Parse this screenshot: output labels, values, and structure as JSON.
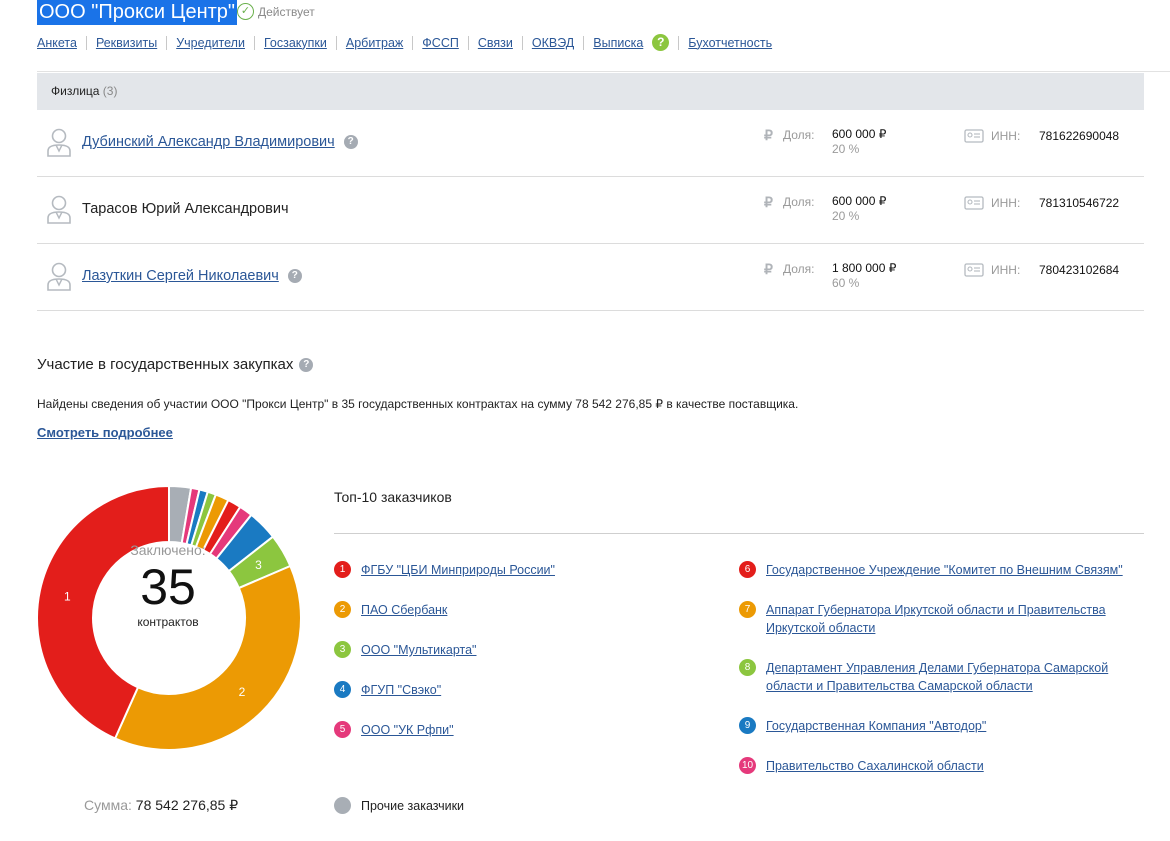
{
  "company": {
    "title": "ООО \"Прокси Центр\"",
    "status": "Действует"
  },
  "nav": [
    "Анкета",
    "Реквизиты",
    "Учредители",
    "Госзакупки",
    "Арбитраж",
    "ФССП",
    "Связи",
    "ОКВЭД",
    "Выписка",
    "Бухотчетность"
  ],
  "nav_help": "?",
  "founders": {
    "header": "Физлица",
    "count": "(3)",
    "share_label": "Доля:",
    "inn_label": "ИНН:",
    "rub_sign": "₽",
    "persons": [
      {
        "name": "Дубинский Александр Владимирович",
        "share": "600 000 ₽",
        "percent": "20 %",
        "inn": "781622690048"
      },
      {
        "name": "Тарасов Юрий Александрович",
        "share": "600 000 ₽",
        "percent": "20 %",
        "inn": "781310546722"
      },
      {
        "name": "Лазуткин Сергей Николаевич",
        "share": "1 800 000 ₽",
        "percent": "60 %",
        "inn": "780423102684"
      }
    ]
  },
  "procurement": {
    "title": "Участие в государственных закупках",
    "found_text": "Найдены сведения об участии ООО \"Прокси Центр\" в 35 государственных контрактах на сумму 78 542 276,85 ₽ в качестве поставщика.",
    "more_link": "Смотреть подробнее",
    "donut_label": "Заключено:",
    "contracts_count": "35",
    "contracts_unit": "контрактов",
    "sum_label": "Сумма:",
    "sum_value": "78 542 276,85 ₽",
    "top10_title": "Топ-10 заказчиков",
    "customers": [
      {
        "n": "1",
        "name": "ФГБУ \"ЦБИ Минприроды России\"",
        "color": "#e31e1b"
      },
      {
        "n": "2",
        "name": "ПАО Сбербанк",
        "color": "#ec9a04"
      },
      {
        "n": "3",
        "name": "ООО \"Мультикарта\"",
        "color": "#8cc63f"
      },
      {
        "n": "4",
        "name": "ФГУП \"Свэко\"",
        "color": "#1a7ac2"
      },
      {
        "n": "5",
        "name": "ООО \"УК Рфпи\"",
        "color": "#e5397b"
      },
      {
        "n": "6",
        "name": "Государственное Учреждение \"Комитет по Внешним Связям\"",
        "color": "#e31e1b"
      },
      {
        "n": "7",
        "name": "Аппарат Губернатора Иркутской области и Правительства Иркутской области",
        "color": "#ec9a04"
      },
      {
        "n": "8",
        "name": "Департамент Управления Делами Губернатора Самарской области и Правительства Самарской области",
        "color": "#8cc63f"
      },
      {
        "n": "9",
        "name": "Государственная Компания \"Автодор\"",
        "color": "#1a7ac2"
      },
      {
        "n": "10",
        "name": "Правительство Сахалинской области",
        "color": "#e5397b"
      }
    ],
    "others_label": "Прочие заказчики",
    "others_color": "#a8aeb5"
  },
  "chart_data": {
    "type": "pie",
    "title": "Заключено:",
    "center_value": "35",
    "center_unit": "контрактов",
    "slices": [
      {
        "label": "1",
        "value": 42.0,
        "color": "#e31e1b"
      },
      {
        "label": "2",
        "value": 37.0,
        "color": "#ec9a04"
      },
      {
        "label": "3",
        "value": 4.0,
        "color": "#8cc63f"
      },
      {
        "label": "4",
        "value": 3.6,
        "color": "#1a7ac2"
      },
      {
        "label": "5",
        "value": 1.6,
        "color": "#e5397b"
      },
      {
        "label": "6",
        "value": 1.6,
        "color": "#e31e1b"
      },
      {
        "label": "7",
        "value": 1.6,
        "color": "#ec9a04"
      },
      {
        "label": "8",
        "value": 1.0,
        "color": "#8cc63f"
      },
      {
        "label": "9",
        "value": 1.0,
        "color": "#1a7ac2"
      },
      {
        "label": "10",
        "value": 1.0,
        "color": "#e5397b"
      },
      {
        "label": "others",
        "value": 2.6,
        "color": "#a8aeb5"
      }
    ],
    "labeled_slices": [
      "1",
      "2",
      "3"
    ]
  }
}
